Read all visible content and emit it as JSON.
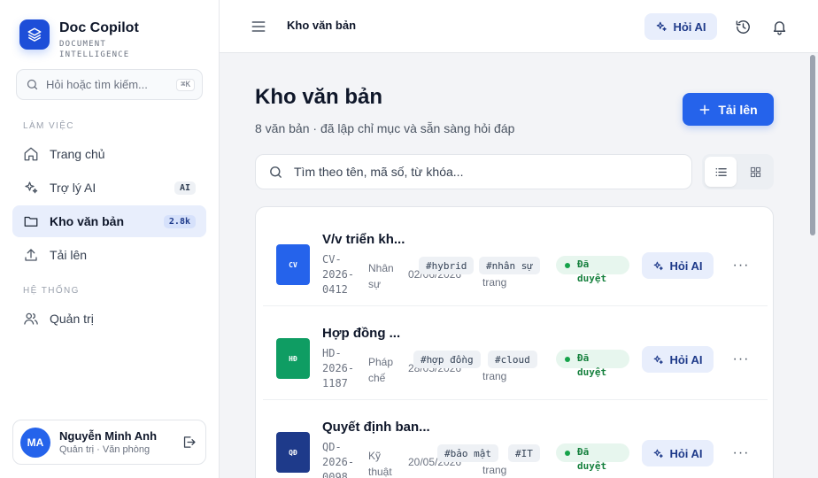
{
  "brand": {
    "name": "Doc Copilot",
    "sub": "DOCUMENT INTELLIGENCE"
  },
  "sidebar_search": {
    "placeholder": "Hỏi hoặc tìm kiếm...",
    "shortcut": "⌘K"
  },
  "sections": {
    "work": "LÀM VIỆC",
    "system": "HỆ THỐNG"
  },
  "nav": [
    {
      "label": "Trang chủ",
      "icon": "home-icon"
    },
    {
      "label": "Trợ lý AI",
      "badge": "AI",
      "icon": "sparkles-icon"
    },
    {
      "label": "Kho văn bản",
      "badge": "2.8k",
      "icon": "folder-icon",
      "active": true
    },
    {
      "label": "Tải lên",
      "icon": "upload-icon"
    },
    {
      "label": "Quản trị",
      "icon": "users-icon"
    }
  ],
  "user": {
    "initials": "MA",
    "name": "Nguyễn Minh Anh",
    "role": "Quản trị · Văn phòng"
  },
  "topbar": {
    "breadcrumb": "Kho văn bản",
    "ask_label": "Hỏi AI"
  },
  "page": {
    "title": "Kho văn bản",
    "subtitle": "8 văn bản · đã lập chỉ mục và sẵn sàng hỏi đáp",
    "upload_label": "Tải lên",
    "search_placeholder": "Tìm theo tên, mã số, từ khóa..."
  },
  "colors": {
    "primary": "#2563eb",
    "cv": "#2563eb",
    "hd": "#0f9d63",
    "qd": "#1e3a8a",
    "approved": "#16a34a"
  },
  "documents": [
    {
      "badge": "CV",
      "title": "V/v triển kh...",
      "code": "CV-2026-0412",
      "dept": "Nhân sự",
      "date": "02/06/2026",
      "pages": "trang",
      "tags": [
        "#hybrid",
        "#nhân sự"
      ],
      "status": "Đã duyệt",
      "ask_label": "Hỏi AI",
      "more": "···"
    },
    {
      "badge": "HĐ",
      "title": "Hợp đồng ...",
      "code": "HD-2026-1187",
      "dept": "Pháp chế",
      "date": "28/05/2026",
      "pages": "trang",
      "tags": [
        "#hợp đồng",
        "#cloud"
      ],
      "status": "Đã duyệt",
      "ask_label": "Hỏi AI",
      "more": "···"
    },
    {
      "badge": "QĐ",
      "title": "Quyết định ban...",
      "code": "QD-2026-0098",
      "dept": "Kỹ thuật",
      "date": "20/05/2026",
      "pages": "trang",
      "tags": [
        "#bảo mật",
        "#IT"
      ],
      "status": "Đã duyệt",
      "ask_label": "Hỏi AI",
      "more": "···"
    }
  ]
}
